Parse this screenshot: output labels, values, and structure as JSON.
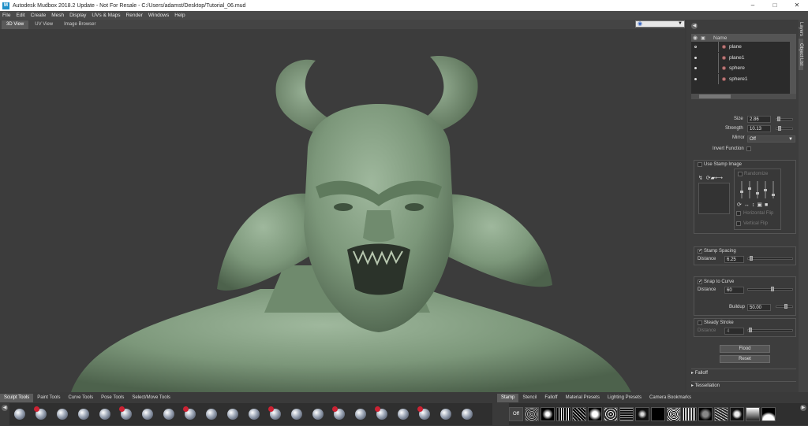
{
  "window": {
    "title": "Autodesk Mudbox 2018.2 Update - Not For Resale - C:/Users/adamst/Desktop/Tutorial_06.mud",
    "app_icon": "M",
    "minimize": "–",
    "maximize": "□",
    "close": "✕"
  },
  "menu": [
    "File",
    "Edit",
    "Create",
    "Mesh",
    "Display",
    "UVs & Maps",
    "Render",
    "Windows",
    "Help"
  ],
  "view_tabs": [
    "3D View",
    "UV View",
    "Image Browser"
  ],
  "side_tabs": [
    "Layers",
    "Object List"
  ],
  "outliner": {
    "header": "Name",
    "items": [
      {
        "name": "plane",
        "visible": false
      },
      {
        "name": "plane1",
        "visible": true
      },
      {
        "name": "sphere",
        "visible": true
      },
      {
        "name": "sphere1",
        "visible": true
      }
    ]
  },
  "properties": {
    "size_label": "Size",
    "size_value": "2.86",
    "strength_label": "Strength",
    "strength_value": "10.13",
    "mirror_label": "Mirror",
    "mirror_value": "Off",
    "invert_label": "Invert Function",
    "use_stamp_label": "Use Stamp Image",
    "randomize_label": "Randomize",
    "hflip_label": "Horizontal Flip",
    "vflip_label": "Vertical Flip",
    "stamp_spacing_label": "Stamp Spacing",
    "stamp_distance_label": "Distance",
    "stamp_distance_value": "6.25",
    "snap_label": "Snap to Curve",
    "snap_distance_label": "Distance",
    "snap_distance_value": "60",
    "buildup_label": "Buildup",
    "buildup_value": "50.00",
    "steady_label": "Steady Stroke",
    "steady_distance_label": "Distance",
    "steady_distance_value": "4",
    "flood_label": "Flood",
    "reset_label": "Reset",
    "falloff_label": "Falloff",
    "tessellation_label": "Tessellation"
  },
  "tool_tabs": [
    "Sculpt Tools",
    "Paint Tools",
    "Curve Tools",
    "Pose Tools",
    "Select/Move Tools"
  ],
  "stamp_tabs": [
    "Stamp",
    "Stencil",
    "Falloff",
    "Material Presets",
    "Lighting Presets",
    "Camera Bookmarks"
  ],
  "stamp_off_label": "Off",
  "colors": {
    "model": "#7f9a7e",
    "viewport_bg": "#3c3c3c",
    "panel_bg": "#3d3d3d"
  }
}
